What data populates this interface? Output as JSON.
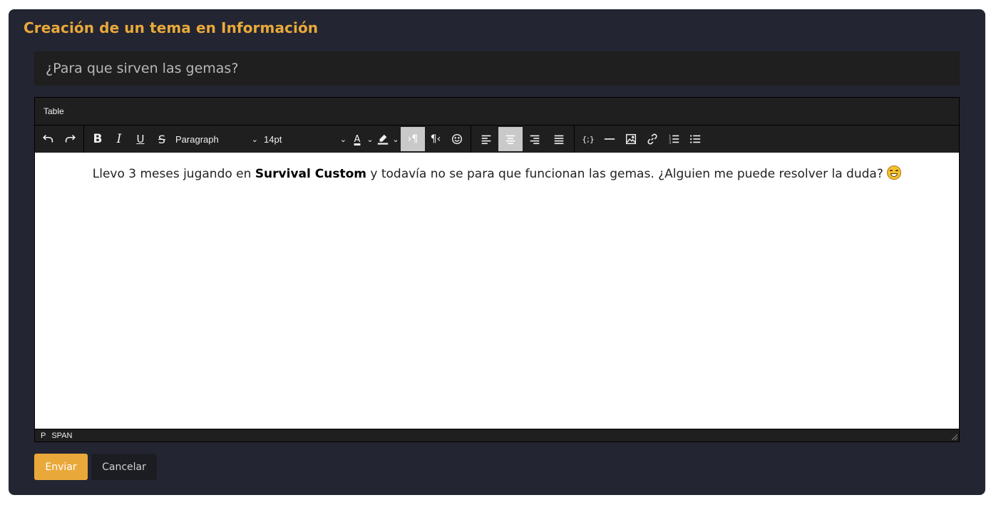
{
  "page": {
    "title": "Creación de un tema en Información"
  },
  "topic": {
    "title_value": "¿Para que sirven las gemas?"
  },
  "editor": {
    "menubar": {
      "items": [
        {
          "label": "Table"
        }
      ]
    },
    "toolbar": {
      "block_format": "Paragraph",
      "font_size": "14pt",
      "text_color_letter": "A",
      "icons": [
        "undo-icon",
        "redo-icon",
        "bold-icon",
        "italic-icon",
        "underline-icon",
        "strikethrough-icon",
        "text-color-icon",
        "highlight-icon",
        "ltr-icon",
        "rtl-icon",
        "emoticons-icon",
        "align-left-icon",
        "align-center-icon",
        "align-right-icon",
        "align-justify-icon",
        "code-icon",
        "horizontal-rule-icon",
        "image-icon",
        "link-icon",
        "numbered-list-icon",
        "bullet-list-icon"
      ],
      "active": [
        "ltr-icon",
        "align-center-icon"
      ]
    },
    "content": {
      "before": "Llevo 3 meses jugando en ",
      "bold": "Survival Custom",
      "after": " y todavía no se para que funcionan las gemas. ¿Alguien me puede resolver la duda? ",
      "emoji": "grinning-face"
    },
    "statusbar": {
      "path": [
        "P",
        "SPAN"
      ]
    }
  },
  "actions": {
    "send_label": "Enviar",
    "cancel_label": "Cancelar"
  },
  "colors": {
    "accent": "#e9a93a",
    "card_bg": "#232532",
    "toolbar_bg": "#1f1f1f"
  }
}
